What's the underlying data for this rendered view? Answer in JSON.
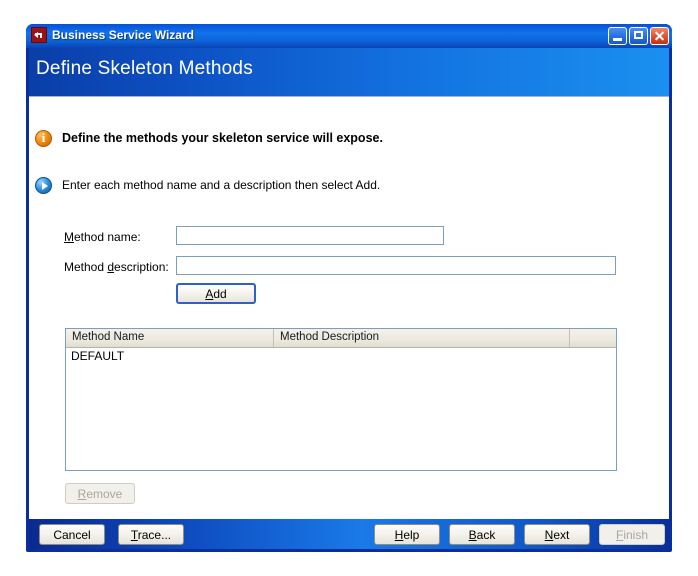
{
  "window": {
    "title": "Business Service Wizard",
    "app_icon": "service-arrow-icon",
    "controls": {
      "minimize": "minimize-icon",
      "maximize": "maximize-icon",
      "close": "close-icon"
    }
  },
  "banner": {
    "heading": "Define Skeleton Methods",
    "accent_color": "#1372e0"
  },
  "info": {
    "primary_icon": "info-icon",
    "primary_text": "Define the methods your skeleton service will expose.",
    "secondary_icon": "arrow-icon",
    "secondary_text": "Enter each method name and a description then select Add."
  },
  "form": {
    "method_name": {
      "label_pre": "",
      "label_mnemonic": "M",
      "label_post": "ethod name:",
      "value": "",
      "placeholder": ""
    },
    "method_description": {
      "label_pre": "Method ",
      "label_mnemonic": "d",
      "label_post": "escription:",
      "value": "",
      "placeholder": ""
    },
    "add_button": {
      "pre": "",
      "mnemonic": "A",
      "post": "dd",
      "enabled": true,
      "focused": true
    },
    "remove_button": {
      "pre": "",
      "mnemonic": "R",
      "post": "emove",
      "enabled": false
    }
  },
  "table": {
    "columns": [
      "Method Name",
      "Method Description",
      ""
    ],
    "rows": [
      {
        "name": "DEFAULT",
        "description": "",
        "extra": ""
      }
    ]
  },
  "footer": {
    "cancel": {
      "pre": "Cancel",
      "mnemonic": "",
      "post": "",
      "enabled": true
    },
    "trace": {
      "pre": "",
      "mnemonic": "T",
      "post": "race...",
      "enabled": true
    },
    "help": {
      "pre": "",
      "mnemonic": "H",
      "post": "elp",
      "enabled": true
    },
    "back": {
      "pre": "",
      "mnemonic": "B",
      "post": "ack",
      "enabled": true
    },
    "next": {
      "pre": "",
      "mnemonic": "N",
      "post": "ext",
      "enabled": true
    },
    "finish": {
      "pre": "",
      "mnemonic": "F",
      "post": "inish",
      "enabled": false
    }
  }
}
